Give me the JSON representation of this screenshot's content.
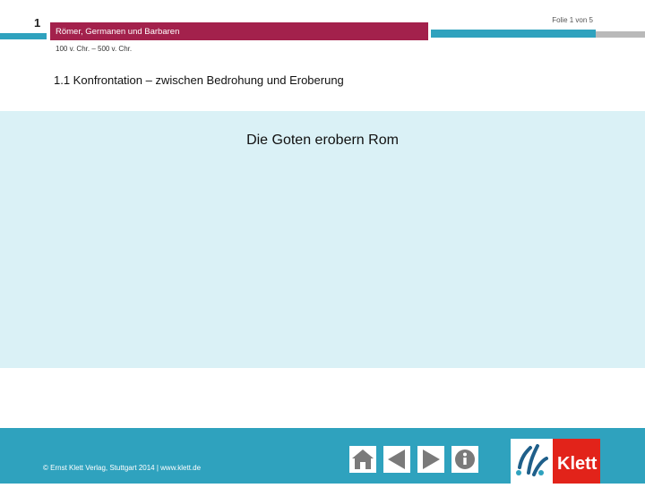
{
  "header": {
    "chapter_number": "1",
    "title": "Römer, Germanen und Barbaren",
    "period": "100 v. Chr. – 500 v. Chr.",
    "slide_count": "Folie 1 von 5"
  },
  "section": {
    "heading": "1.1  Konfrontation – zwischen Bedrohung und Eroberung"
  },
  "content": {
    "title": "Die Goten erobern Rom"
  },
  "footer": {
    "copyright": "© Ernst Klett Verlag, Stuttgart 2014 | www.klett.de",
    "nav_icons": [
      "home-icon",
      "back-arrow-icon",
      "forward-arrow-icon",
      "info-icon"
    ],
    "logo_text": "Klett"
  },
  "colors": {
    "accent": "#a3214c",
    "teal": "#2fa2be",
    "panel": "#daf1f6",
    "logo_red": "#e2231a",
    "button_gray": "#7a7a7a"
  }
}
